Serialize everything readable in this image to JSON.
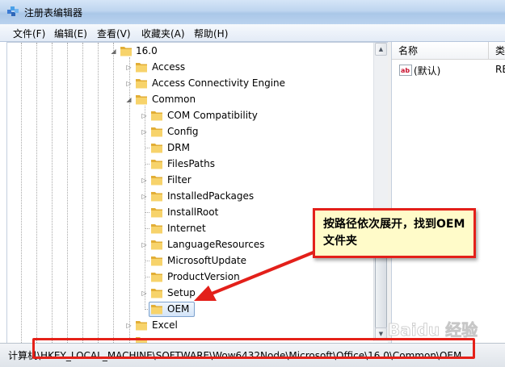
{
  "window": {
    "title": "注册表编辑器"
  },
  "menu": [
    "文件(F)",
    "编辑(E)",
    "查看(V)",
    "收藏夹(A)",
    "帮助(H)"
  ],
  "tree": [
    {
      "label": "16.0",
      "expander": "open"
    },
    {
      "label": "Access",
      "expander": "closed"
    },
    {
      "label": "Access Connectivity Engine",
      "expander": "closed"
    },
    {
      "label": "Common",
      "expander": "open"
    },
    {
      "label": "COM Compatibility",
      "expander": "closed"
    },
    {
      "label": "Config",
      "expander": "closed"
    },
    {
      "label": "DRM",
      "expander": "none"
    },
    {
      "label": "FilesPaths",
      "expander": "none"
    },
    {
      "label": "Filter",
      "expander": "closed"
    },
    {
      "label": "InstalledPackages",
      "expander": "closed"
    },
    {
      "label": "InstallRoot",
      "expander": "none"
    },
    {
      "label": "Internet",
      "expander": "none"
    },
    {
      "label": "LanguageResources",
      "expander": "closed"
    },
    {
      "label": "MicrosoftUpdate",
      "expander": "none"
    },
    {
      "label": "ProductVersion",
      "expander": "none"
    },
    {
      "label": "Setup",
      "expander": "closed"
    },
    {
      "label": "OEM",
      "expander": "none",
      "selected": true
    },
    {
      "label": "Excel",
      "expander": "closed"
    }
  ],
  "list": {
    "columns": [
      "名称",
      "类"
    ],
    "rows": [
      {
        "name": "(默认)",
        "type": "RE",
        "icon": "string-value-icon"
      }
    ]
  },
  "status": {
    "path": "计算机\\HKEY_LOCAL_MACHINE\\SOFTWARE\\Wow6432Node\\Microsoft\\Office\\16.0\\Common\\OEM"
  },
  "annotation": {
    "text": "按路径依次展开，找到OEM文件夹"
  },
  "watermark": {
    "text": "Baidu 经验"
  },
  "colors": {
    "highlight": "#e52119",
    "callout_bg": "#fffbc9",
    "folder": "#f0c24a"
  }
}
